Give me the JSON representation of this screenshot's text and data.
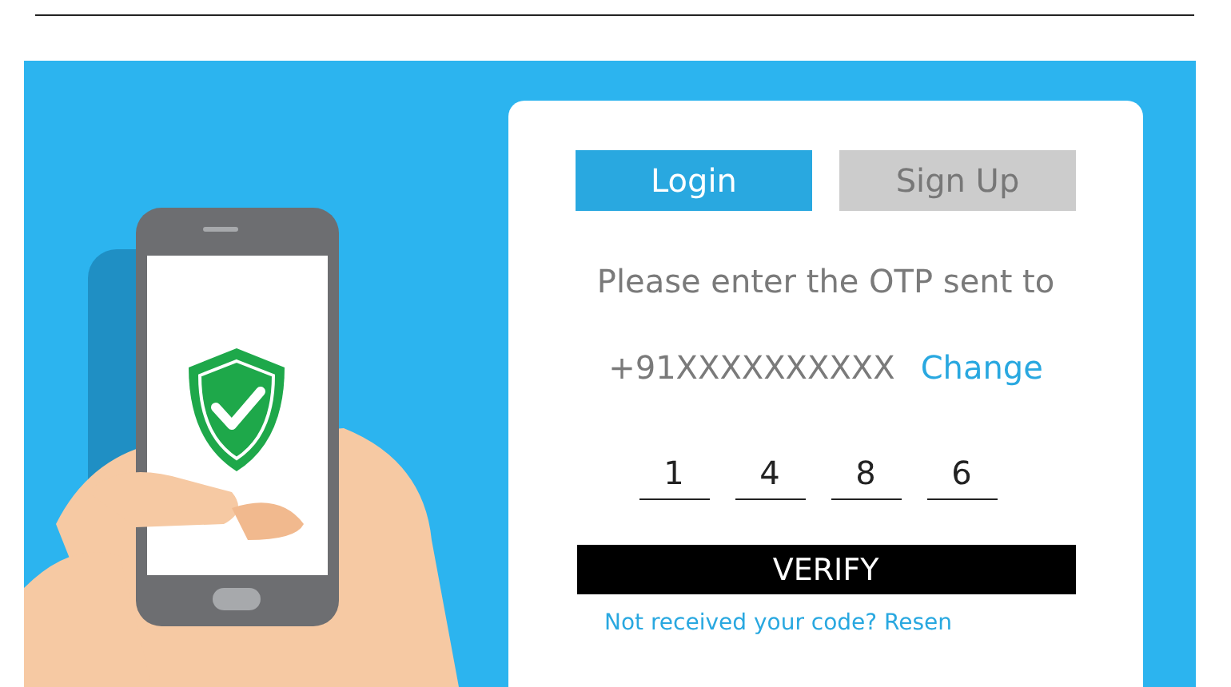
{
  "tabs": [
    {
      "label": "Login",
      "selected": true
    },
    {
      "label": "Sign Up",
      "selected": false
    }
  ],
  "prompt": "Please enter the OTP sent to",
  "phone_number": "+91XXXXXXXXXX",
  "change_link": "Change",
  "otp_digits": [
    "1",
    "4",
    "8",
    "6"
  ],
  "verify_button": "VERIFY",
  "resend_text": "Not received your code? Resen"
}
